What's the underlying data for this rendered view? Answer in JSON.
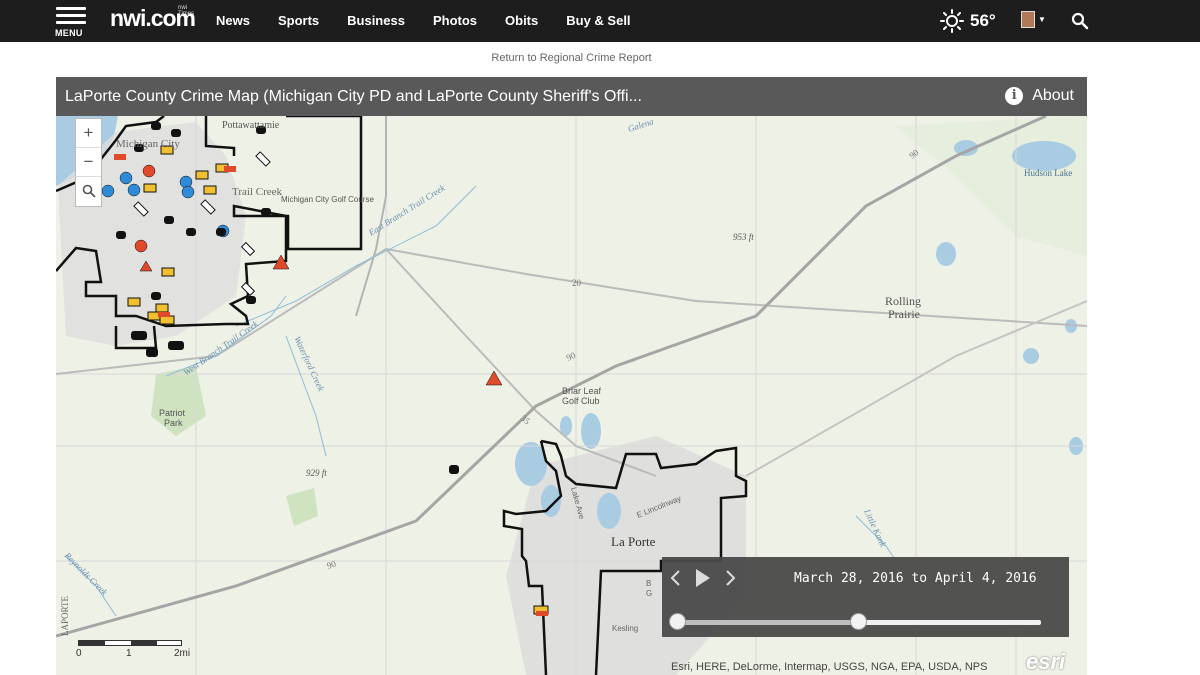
{
  "nav": {
    "menu_label": "MENU",
    "logo_text": "nwi.com",
    "logo_tag": "nwi Times",
    "items": [
      "News",
      "Sports",
      "Business",
      "Photos",
      "Obits",
      "Buy & Sell"
    ],
    "weather_temp": "56°"
  },
  "return_link": "Return to Regional Crime Report",
  "map": {
    "title": "LaPorte County Crime Map (Michigan City PD and LaPorte County Sheriff's Offi...",
    "about_label": "About",
    "zoom_in": "+",
    "zoom_out": "−",
    "labels": {
      "potawatomie": "Pottawattamie",
      "michigan_city": "Michigan City",
      "trail_creek": "Trail Creek",
      "golf_course": "Michigan City Golf Course",
      "galena": "Galena",
      "hudson_lake": "Hudson Lake",
      "east_branch": "East Branch Trail Creek",
      "elev_953": "953 ft",
      "elev_929": "929 ft",
      "route_90a": "90",
      "route_90b": "90",
      "route_90c": "90",
      "route_20": "20",
      "route_35": "35",
      "rolling_1": "Rolling",
      "rolling_2": "Prairie",
      "briar_1": "Briar Leaf",
      "briar_2": "Golf Club",
      "patriot_1": "Patriot",
      "patriot_2": "Park",
      "waterford": "Waterford Creek",
      "west_branch": "West Branch Trail Creek",
      "la_porte": "La Porte",
      "lincolnway": "E Lincolnway",
      "lake_ave": "Lake Ave",
      "kesling": "Kesling",
      "little_kank": "Little Kank",
      "reynolds": "Reynolds Creek",
      "laporte_side": "LAPORTE",
      "bed_1": "B",
      "bed_2": "G"
    },
    "scale": {
      "zero": "0",
      "one": "1",
      "two": "2mi"
    },
    "attribution": "Esri, HERE, DeLorme, Intermap, USGS, NGA, EPA, USDA, NPS",
    "esri_logo": "esri"
  },
  "time_slider": {
    "range_text": "March 28, 2016 to April 4, 2016",
    "start_fraction": 0.0,
    "end_fraction": 0.5
  }
}
